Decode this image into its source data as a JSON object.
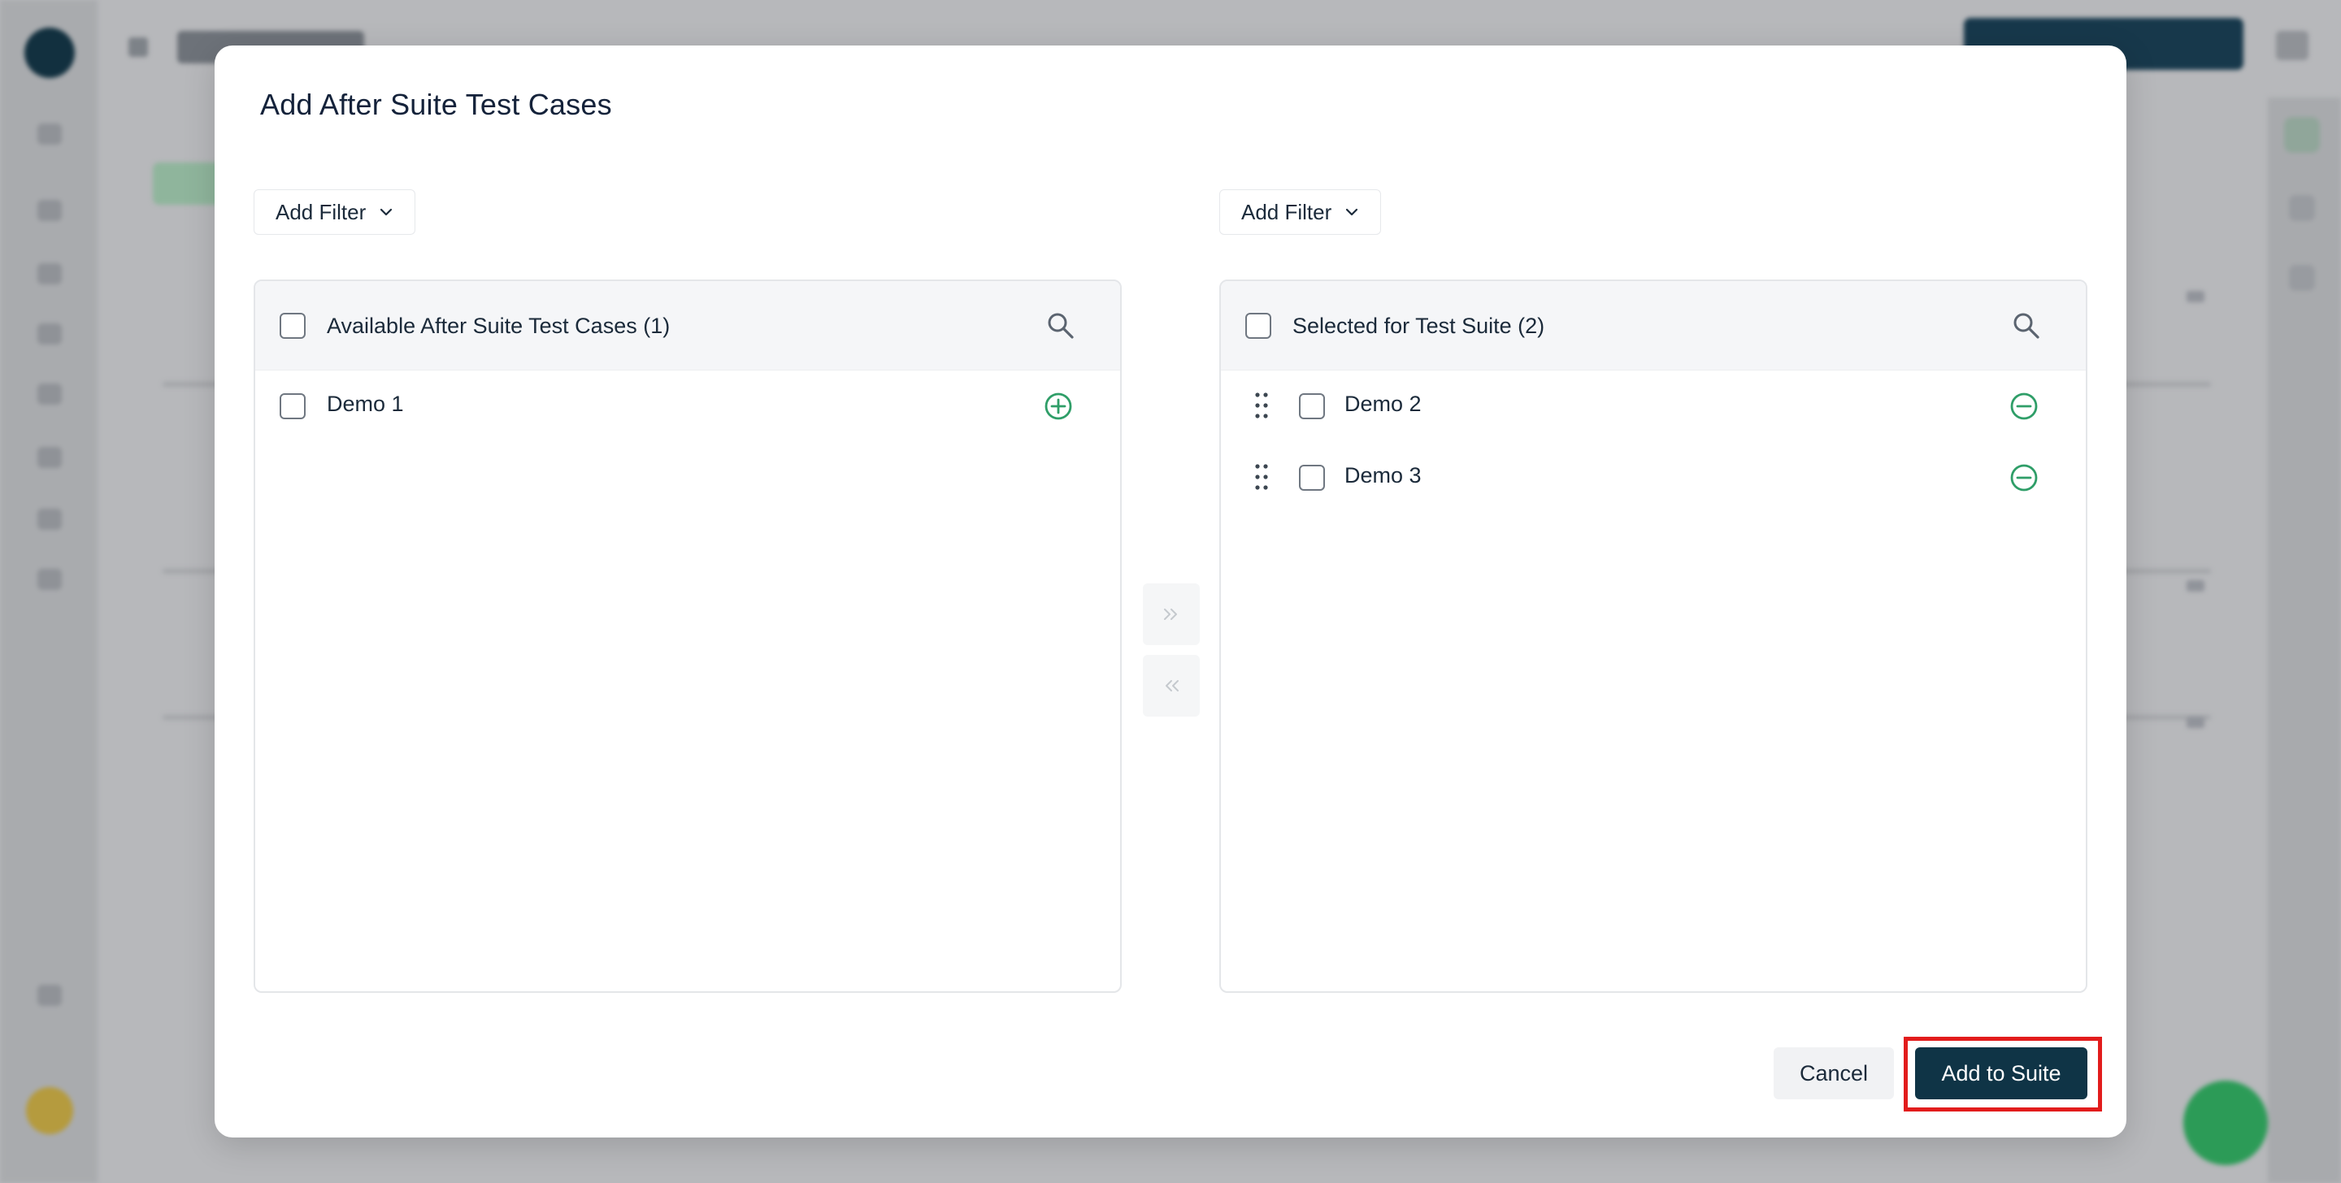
{
  "modal": {
    "title": "Add After Suite Test Cases",
    "left_filter_label": "Add Filter",
    "right_filter_label": "Add Filter",
    "available_panel": {
      "title": "Available After Suite Test Cases (1)",
      "items": [
        {
          "label": "Demo 1",
          "action_icon": "plus-circle-icon"
        }
      ]
    },
    "selected_panel": {
      "title": "Selected for Test Suite (2)",
      "items": [
        {
          "label": "Demo 2",
          "action_icon": "minus-circle-icon"
        },
        {
          "label": "Demo 3",
          "action_icon": "minus-circle-icon"
        }
      ]
    },
    "transfer_buttons": {
      "move_right_icon": "chevrons-right-icon",
      "move_left_icon": "chevrons-left-icon"
    },
    "cancel_label": "Cancel",
    "add_to_suite_label": "Add to Suite"
  },
  "colors": {
    "primary": "#0f3446",
    "success": "#2f9e68",
    "highlight_outline": "#e21c1c",
    "overlay": "#b7b8bb"
  }
}
